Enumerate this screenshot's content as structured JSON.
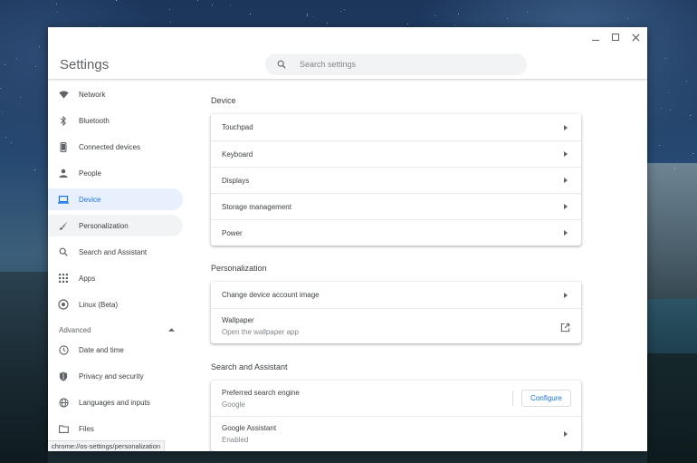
{
  "window": {
    "title": "Settings"
  },
  "search": {
    "placeholder": "Search settings"
  },
  "sidebar": {
    "items": [
      {
        "label": "Network",
        "icon": "wifi-icon"
      },
      {
        "label": "Bluetooth",
        "icon": "bluetooth-icon"
      },
      {
        "label": "Connected devices",
        "icon": "phone-icon"
      },
      {
        "label": "People",
        "icon": "person-icon"
      },
      {
        "label": "Device",
        "icon": "laptop-icon",
        "selected": true
      },
      {
        "label": "Personalization",
        "icon": "brush-icon"
      },
      {
        "label": "Search and Assistant",
        "icon": "search-icon"
      },
      {
        "label": "Apps",
        "icon": "apps-grid-icon"
      },
      {
        "label": "Linux (Beta)",
        "icon": "linux-icon"
      }
    ],
    "advanced_label": "Advanced",
    "advanced_items": [
      {
        "label": "Date and time",
        "icon": "clock-icon"
      },
      {
        "label": "Privacy and security",
        "icon": "shield-icon"
      },
      {
        "label": "Languages and inputs",
        "icon": "globe-icon"
      },
      {
        "label": "Files",
        "icon": "folder-icon"
      }
    ]
  },
  "main": {
    "device": {
      "title": "Device",
      "rows": [
        "Touchpad",
        "Keyboard",
        "Displays",
        "Storage management",
        "Power"
      ]
    },
    "personalization": {
      "title": "Personalization",
      "change_image": "Change device account image",
      "wallpaper": "Wallpaper",
      "wallpaper_sub": "Open the wallpaper app"
    },
    "search_assistant": {
      "title": "Search and Assistant",
      "engine_label": "Preferred search engine",
      "engine_value": "Google",
      "configure": "Configure",
      "assistant_label": "Google Assistant",
      "assistant_value": "Enabled"
    }
  },
  "status_url": "chrome://os-settings/personalization",
  "colors": {
    "accent": "#1a73e8",
    "selected_bg": "#e8f0fe",
    "text": "#3c4043",
    "secondary": "#80868b"
  }
}
